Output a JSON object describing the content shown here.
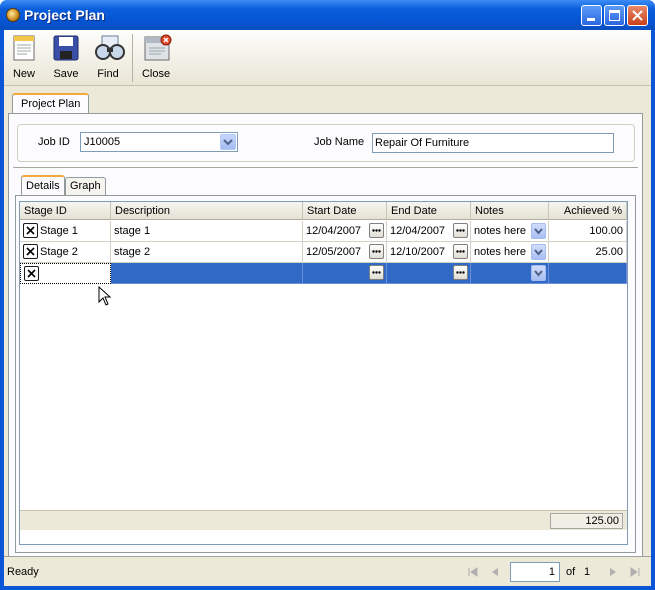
{
  "window": {
    "title": "Project Plan"
  },
  "toolbar": {
    "new": "New",
    "save": "Save",
    "find": "Find",
    "close": "Close"
  },
  "outer_tab": "Project Plan",
  "form": {
    "job_id_label": "Job ID",
    "job_id_value": "J10005",
    "job_name_label": "Job Name",
    "job_name_value": "Repair Of Furniture"
  },
  "inner_tabs": [
    "Details",
    "Graph"
  ],
  "grid": {
    "columns": [
      "Stage ID",
      "Description",
      "Start Date",
      "End Date",
      "Notes",
      "Achieved %"
    ],
    "rows": [
      {
        "stage_id": "Stage 1",
        "description": "stage 1",
        "start_date": "12/04/2007",
        "end_date": "12/04/2007",
        "notes": "notes here",
        "achieved": "100.00"
      },
      {
        "stage_id": "Stage 2",
        "description": "stage 2",
        "start_date": "12/05/2007",
        "end_date": "12/10/2007",
        "notes": "notes here",
        "achieved": "25.00"
      }
    ],
    "total": "125.00"
  },
  "status": {
    "text": "Ready",
    "page": "1",
    "of": "of",
    "total_pages": "1"
  },
  "colors": {
    "selection": "#316ac5",
    "titlebar": "#0a56d6",
    "accent_tab": "#f2a93b"
  }
}
